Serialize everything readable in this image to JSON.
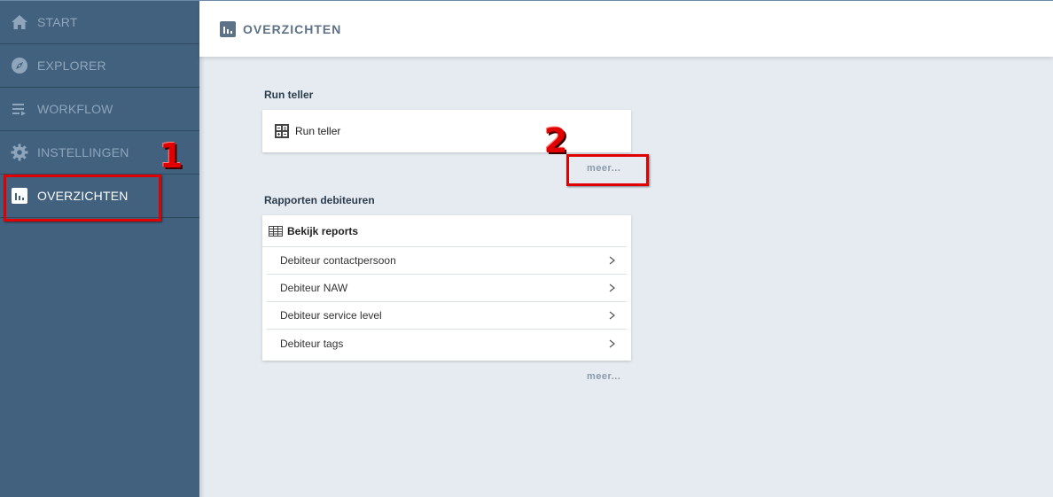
{
  "sidebar": {
    "items": [
      {
        "label": "START",
        "icon": "home-icon"
      },
      {
        "label": "EXPLORER",
        "icon": "compass-icon"
      },
      {
        "label": "WORKFLOW",
        "icon": "workflow-icon"
      },
      {
        "label": "INSTELLINGEN",
        "icon": "gear-icon"
      },
      {
        "label": "OVERZICHTEN",
        "icon": "bar-chart-icon",
        "active": true
      }
    ]
  },
  "header": {
    "title": "OVERZICHTEN",
    "icon": "bar-chart-icon"
  },
  "sections": {
    "run_teller": {
      "title": "Run teller",
      "card_label": "Run teller",
      "card_icon": "calculator-icon",
      "more": "meer..."
    },
    "rapporten": {
      "title": "Rapporten debiteuren",
      "card_title": "Bekijk reports",
      "card_icon": "table-icon",
      "rows": [
        "Debiteur contactpersoon",
        "Debiteur NAW",
        "Debiteur service level",
        "Debiteur tags"
      ],
      "more": "meer..."
    }
  },
  "annotations": {
    "step1": "1",
    "step2": "2"
  },
  "colors": {
    "sidebar": "#41617e",
    "background": "#e6ebf2",
    "annotation": "#e00000"
  }
}
